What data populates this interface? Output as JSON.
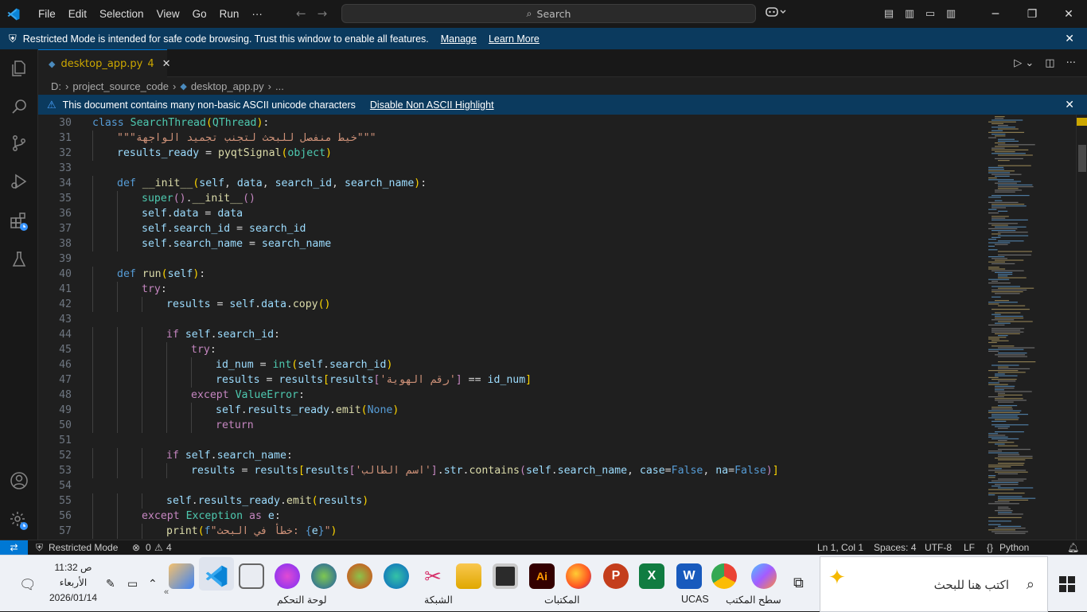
{
  "title_bar": {
    "menus": [
      "File",
      "Edit",
      "Selection",
      "View",
      "Go",
      "Run",
      "···"
    ],
    "search_label": "Search"
  },
  "restricted_banner": {
    "text": "Restricted Mode is intended for safe code browsing. Trust this window to enable all features.",
    "manage_link": "Manage",
    "learn_more_link": "Learn More"
  },
  "tab": {
    "filename": "desktop_app.py",
    "problem_count": "4"
  },
  "breadcrumb": {
    "drive": "D:",
    "folder": "project_source_code",
    "file": "desktop_app.py",
    "more": "..."
  },
  "ascii_banner": {
    "text": "This document contains many non-basic ASCII unicode characters",
    "action": "Disable Non ASCII Highlight"
  },
  "code_lines": [
    {
      "n": "30",
      "indent": 0,
      "html": "<span class='kw'>class</span> <span class='cls'>SearchThread</span><span class='brk'>(</span><span class='cls'>QThread</span><span class='brk'>)</span><span class='plain'>:</span>"
    },
    {
      "n": "31",
      "indent": 1,
      "html": "<span class='str'>\"\"\"خيط منفصل للبحث لتجنب تجميد الواجهة\"\"\"</span>"
    },
    {
      "n": "32",
      "indent": 1,
      "html": "<span class='var'>results_ready</span><span class='plain'> = </span><span class='fn'>pyqtSignal</span><span class='brk'>(</span><span class='cls'>object</span><span class='brk'>)</span>"
    },
    {
      "n": "33",
      "indent": 0,
      "html": ""
    },
    {
      "n": "34",
      "indent": 1,
      "html": "<span class='kw'>def</span> <span class='fn'>__init__</span><span class='brk'>(</span><span class='var'>self</span><span class='plain'>, </span><span class='var'>data</span><span class='plain'>, </span><span class='var'>search_id</span><span class='plain'>, </span><span class='var'>search_name</span><span class='brk'>)</span><span class='plain'>:</span>"
    },
    {
      "n": "35",
      "indent": 2,
      "html": "<span class='cls'>super</span><span class='kc'>()</span><span class='plain'>.</span><span class='fn'>__init__</span><span class='kc'>()</span>"
    },
    {
      "n": "36",
      "indent": 2,
      "html": "<span class='var'>self</span><span class='plain'>.</span><span class='var'>data</span><span class='plain'> = </span><span class='var'>data</span>"
    },
    {
      "n": "37",
      "indent": 2,
      "html": "<span class='var'>self</span><span class='plain'>.</span><span class='var'>search_id</span><span class='plain'> = </span><span class='var'>search_id</span>"
    },
    {
      "n": "38",
      "indent": 2,
      "html": "<span class='var'>self</span><span class='plain'>.</span><span class='var'>search_name</span><span class='plain'> = </span><span class='var'>search_name</span>"
    },
    {
      "n": "39",
      "indent": 0,
      "html": ""
    },
    {
      "n": "40",
      "indent": 1,
      "html": "<span class='kw'>def</span> <span class='fn'>run</span><span class='brk'>(</span><span class='var'>self</span><span class='brk'>)</span><span class='plain'>:</span>"
    },
    {
      "n": "41",
      "indent": 2,
      "html": "<span class='kc'>try</span><span class='plain'>:</span>"
    },
    {
      "n": "42",
      "indent": 3,
      "html": "<span class='var'>results</span><span class='plain'> = </span><span class='var'>self</span><span class='plain'>.</span><span class='var'>data</span><span class='plain'>.</span><span class='fn'>copy</span><span class='brk'>()</span>"
    },
    {
      "n": "43",
      "indent": 0,
      "html": ""
    },
    {
      "n": "44",
      "indent": 3,
      "html": "<span class='kc'>if</span> <span class='var'>self</span><span class='plain'>.</span><span class='var'>search_id</span><span class='plain'>:</span>"
    },
    {
      "n": "45",
      "indent": 4,
      "html": "<span class='kc'>try</span><span class='plain'>:</span>"
    },
    {
      "n": "46",
      "indent": 5,
      "html": "<span class='var'>id_num</span><span class='plain'> = </span><span class='cls'>int</span><span class='brk'>(</span><span class='var'>self</span><span class='plain'>.</span><span class='var'>search_id</span><span class='brk'>)</span>"
    },
    {
      "n": "47",
      "indent": 5,
      "html": "<span class='var'>results</span><span class='plain'> = </span><span class='var'>results</span><span class='brk'>[</span><span class='var'>results</span><span class='kc'>[</span><span class='str'>'رقم الهوية'</span><span class='kc'>]</span><span class='plain'> == </span><span class='var'>id_num</span><span class='brk'>]</span>"
    },
    {
      "n": "48",
      "indent": 4,
      "html": "<span class='kc'>except</span> <span class='cls'>ValueError</span><span class='plain'>:</span>"
    },
    {
      "n": "49",
      "indent": 5,
      "html": "<span class='var'>self</span><span class='plain'>.</span><span class='var'>results_ready</span><span class='plain'>.</span><span class='fn'>emit</span><span class='brk'>(</span><span class='kw'>None</span><span class='brk'>)</span>"
    },
    {
      "n": "50",
      "indent": 5,
      "html": "<span class='kc'>return</span>"
    },
    {
      "n": "51",
      "indent": 0,
      "html": ""
    },
    {
      "n": "52",
      "indent": 3,
      "html": "<span class='kc'>if</span> <span class='var'>self</span><span class='plain'>.</span><span class='var'>search_name</span><span class='plain'>:</span>"
    },
    {
      "n": "53",
      "indent": 4,
      "html": "<span class='var'>results</span><span class='plain'> = </span><span class='var'>results</span><span class='brk'>[</span><span class='var'>results</span><span class='kc'>[</span><span class='str'>'اسم الطالب'</span><span class='kc'>]</span><span class='plain'>.</span><span class='var'>str</span><span class='plain'>.</span><span class='fn'>contains</span><span class='kc'>(</span><span class='var'>self</span><span class='plain'>.</span><span class='var'>search_name</span><span class='plain'>, </span><span class='var'>case</span><span class='plain'>=</span><span class='kw'>False</span><span class='plain'>, </span><span class='var'>na</span><span class='plain'>=</span><span class='kw'>False</span><span class='kc'>)</span><span class='brk'>]</span>"
    },
    {
      "n": "54",
      "indent": 0,
      "html": ""
    },
    {
      "n": "55",
      "indent": 3,
      "html": "<span class='var'>self</span><span class='plain'>.</span><span class='var'>results_ready</span><span class='plain'>.</span><span class='fn'>emit</span><span class='brk'>(</span><span class='var'>results</span><span class='brk'>)</span>"
    },
    {
      "n": "56",
      "indent": 2,
      "html": "<span class='kc'>except</span> <span class='cls'>Exception</span> <span class='kc'>as</span> <span class='var'>e</span><span class='plain'>:</span>"
    },
    {
      "n": "57",
      "indent": 3,
      "html": "<span class='fn'>print</span><span class='brk'>(</span><span class='kw'>f</span><span class='str'>\"خطأ في البحث: </span><span class='kw'>{</span><span class='var'>e</span><span class='kw'>}</span><span class='str'>\"</span><span class='brk'>)</span>"
    }
  ],
  "status_bar": {
    "mode": "Restricted Mode",
    "errors": "0",
    "warnings": "4",
    "position": "Ln 1, Col 1",
    "spaces": "Spaces: 4",
    "encoding": "UTF-8",
    "eol": "LF",
    "language": "Python"
  },
  "taskbar": {
    "search_placeholder": "اكتب هنا للبحث",
    "time": "11:32 ص",
    "day": "الأربعاء",
    "date": "2026/01/14",
    "labels": {
      "desktop": "سطح المكتب",
      "ucas": "UCAS",
      "libraries": "المكتبات",
      "network": "الشبكة",
      "control_panel": "لوحة التحكم"
    }
  },
  "colors": {
    "accent": "#0078d4",
    "banner": "#0b3a5e",
    "warning": "#cca700"
  }
}
